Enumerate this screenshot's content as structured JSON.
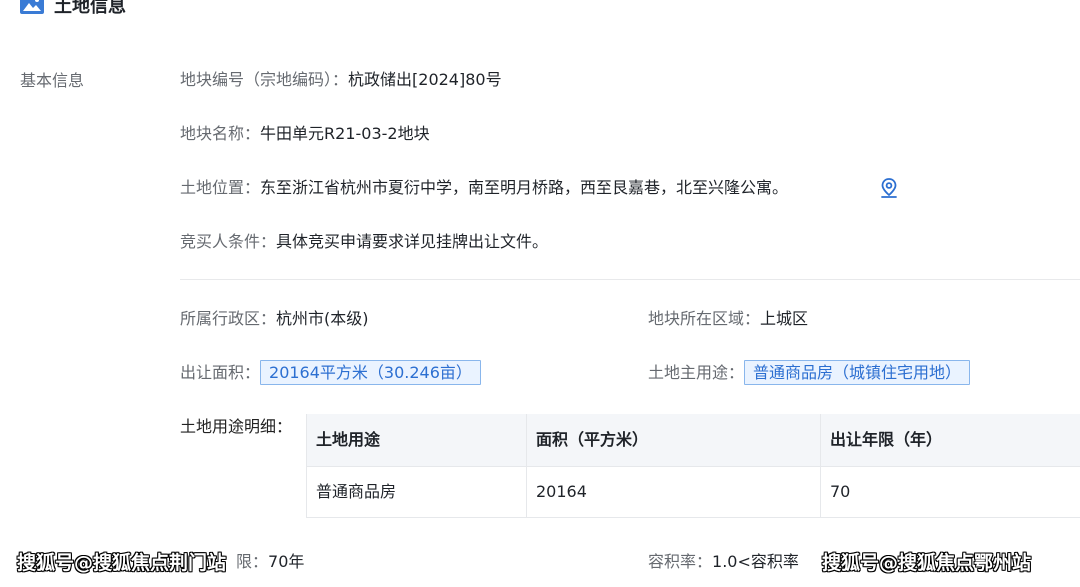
{
  "header": {
    "title": "土地信息",
    "icon": "image-icon"
  },
  "section_label": "基本信息",
  "basic": {
    "parcel_no_label": "地块编号（宗地编码）：",
    "parcel_no_value": "杭政储出[2024]80号",
    "parcel_name_label": "地块名称：",
    "parcel_name_value": "牛田单元R21-03-2地块",
    "location_label": "土地位置：",
    "location_value": "东至浙江省杭州市夏衍中学，南至明月桥路，西至艮嘉巷，北至兴隆公寓。",
    "location_icon": "map-pin-icon",
    "bidder_label": "竞买人条件：",
    "bidder_value": "具体竞买申请要求详见挂牌出让文件。"
  },
  "details": {
    "district_label": "所属行政区：",
    "district_value": "杭州市(本级)",
    "area_zone_label": "地块所在区域：",
    "area_zone_value": "上城区",
    "transfer_area_label": "出让面积：",
    "transfer_area_value": "20164平方米（30.246亩）",
    "main_use_label": "土地主用途：",
    "main_use_value": "普通商品房（城镇住宅用地）",
    "use_detail_label": "土地用途明细："
  },
  "use_table": {
    "headers": [
      "土地用途",
      "面积（平方米）",
      "出让年限（年）"
    ],
    "rows": [
      [
        "普通商品房",
        "20164",
        "70"
      ]
    ]
  },
  "bottom": {
    "term_label_partial": "限：",
    "term_value": "70年",
    "far_label": "容积率：",
    "far_value": "1.0<容积率"
  },
  "watermarks": [
    "搜狐号@搜狐焦点荆门站",
    "搜狐号@搜狐焦点鄂州站"
  ],
  "colors": {
    "accent": "#2c6fd1",
    "chip_bg": "#eaf3ff",
    "chip_border": "#89b6ec",
    "label": "#666a70"
  }
}
